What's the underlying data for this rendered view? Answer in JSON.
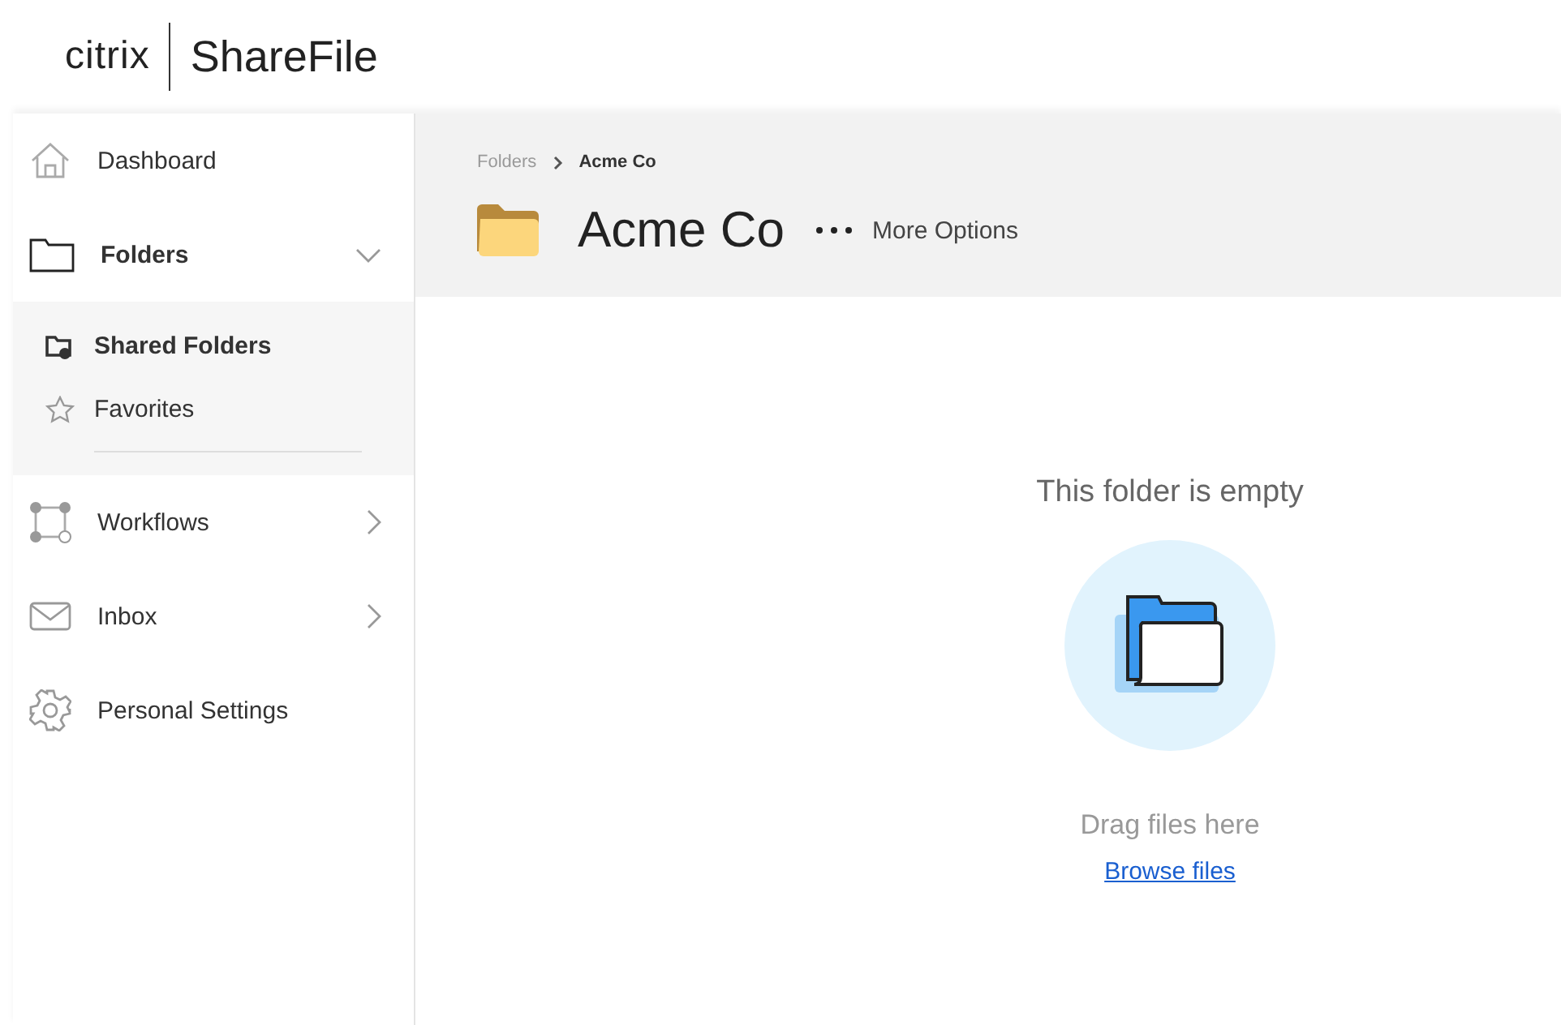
{
  "header": {
    "brand": "citrix",
    "product": "ShareFile"
  },
  "sidebar": {
    "items": [
      {
        "label": "Dashboard",
        "selected": false
      },
      {
        "label": "Folders",
        "selected": true,
        "expanded": true,
        "children": [
          {
            "label": "Shared Folders",
            "selected": true
          },
          {
            "label": "Favorites",
            "selected": false
          }
        ]
      },
      {
        "label": "Workflows",
        "selected": false,
        "expanded": false
      },
      {
        "label": "Inbox",
        "selected": false,
        "expanded": false
      },
      {
        "label": "Personal Settings",
        "selected": false
      }
    ]
  },
  "breadcrumb": [
    {
      "label": "Folders",
      "selected": false
    },
    {
      "label": "Acme Co",
      "selected": true
    }
  ],
  "folder": {
    "title": "Acme Co",
    "more": "More Options"
  },
  "empty_state": {
    "title": "This folder is empty",
    "hint": "Drag files here",
    "link": "Browse files"
  }
}
